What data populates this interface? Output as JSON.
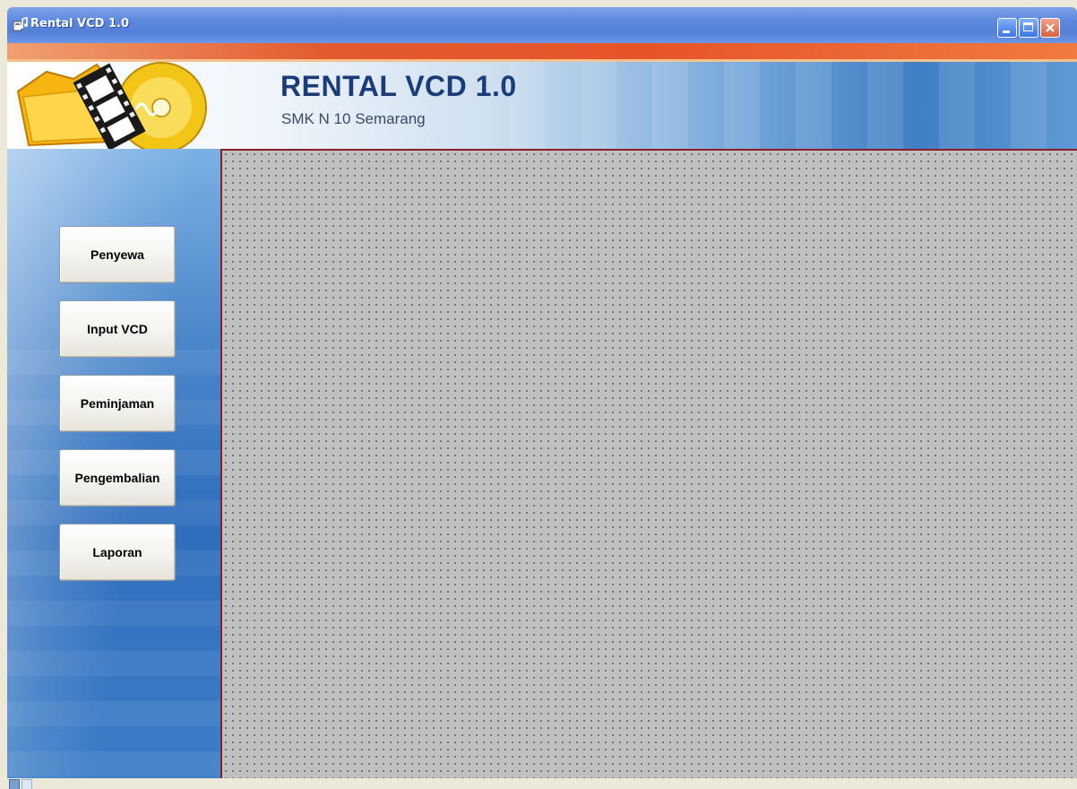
{
  "window": {
    "title": "Rental VCD 1.0",
    "controls": [
      "minimize-icon",
      "maximize-icon",
      "close-icon"
    ]
  },
  "header": {
    "title": "RENTAL VCD 1.0",
    "subtitle": "SMK N 10 Semarang",
    "logo": "folder-film-cd-logo"
  },
  "sidebar": {
    "items": [
      {
        "label": "Penyewa"
      },
      {
        "label": "Input VCD"
      },
      {
        "label": "Peminjaman"
      },
      {
        "label": "Pengembalian"
      },
      {
        "label": "Laporan"
      }
    ]
  },
  "colors": {
    "titlebar": "#5b87de",
    "accent_stripe": "#e8542a",
    "header_text": "#1a3c7a",
    "main_background": "#c0c0c0",
    "divider": "#8a1f2a"
  }
}
